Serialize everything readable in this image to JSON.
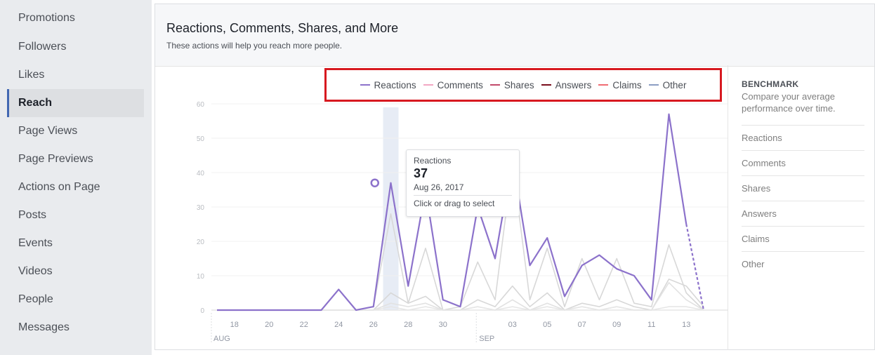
{
  "sidebar": {
    "items": [
      {
        "label": "Promotions",
        "active": false
      },
      {
        "label": "Followers",
        "active": false
      },
      {
        "label": "Likes",
        "active": false
      },
      {
        "label": "Reach",
        "active": true
      },
      {
        "label": "Page Views",
        "active": false
      },
      {
        "label": "Page Previews",
        "active": false
      },
      {
        "label": "Actions on Page",
        "active": false
      },
      {
        "label": "Posts",
        "active": false
      },
      {
        "label": "Events",
        "active": false
      },
      {
        "label": "Videos",
        "active": false
      },
      {
        "label": "People",
        "active": false
      },
      {
        "label": "Messages",
        "active": false
      }
    ]
  },
  "header": {
    "title": "Reactions, Comments, Shares, and More",
    "subtitle": "These actions will help you reach more people."
  },
  "legend": [
    {
      "label": "Reactions",
      "color": "#8c72cb"
    },
    {
      "label": "Comments",
      "color": "#f2a7c3"
    },
    {
      "label": "Shares",
      "color": "#c2496a"
    },
    {
      "label": "Answers",
      "color": "#7a0d1c"
    },
    {
      "label": "Claims",
      "color": "#f06c73"
    },
    {
      "label": "Other",
      "color": "#8b9dc3"
    }
  ],
  "tooltip": {
    "series": "Reactions",
    "value": "37",
    "date": "Aug 26, 2017",
    "hint": "Click or drag to select"
  },
  "benchmark": {
    "title": "BENCHMARK",
    "description": "Compare your average performance over time.",
    "items": [
      "Reactions",
      "Comments",
      "Shares",
      "Answers",
      "Claims",
      "Other"
    ]
  },
  "chart_data": {
    "type": "line",
    "x": [
      "Aug 17",
      "Aug 18",
      "Aug 19",
      "Aug 20",
      "Aug 21",
      "Aug 22",
      "Aug 23",
      "Aug 24",
      "Aug 25",
      "Aug 26",
      "Aug 27",
      "Aug 28",
      "Aug 29",
      "Aug 30",
      "Aug 31",
      "Sep 1",
      "Sep 2",
      "Sep 3",
      "Sep 4",
      "Sep 5",
      "Sep 6",
      "Sep 7",
      "Sep 8",
      "Sep 9",
      "Sep 10",
      "Sep 11",
      "Sep 12",
      "Sep 13",
      "Sep 14"
    ],
    "x_ticks": [
      "18",
      "20",
      "22",
      "24",
      "26",
      "28",
      "30",
      "03",
      "05",
      "07",
      "09",
      "11",
      "13"
    ],
    "month_labels": [
      "AUG",
      "SEP"
    ],
    "y_ticks": [
      0,
      10,
      20,
      30,
      40,
      50,
      60
    ],
    "ylim": [
      0,
      65
    ],
    "grid": true,
    "legend_position": "top",
    "highlight": {
      "series": "Reactions",
      "date": "Aug 26, 2017",
      "value": 37
    },
    "series": [
      {
        "name": "Reactions",
        "color": "#8c72cb",
        "values": [
          0,
          0,
          0,
          0,
          0,
          0,
          0,
          6,
          0,
          1,
          37,
          7,
          35,
          3,
          1,
          30,
          15,
          44,
          13,
          21,
          4,
          13,
          16,
          12,
          10,
          3,
          57,
          25,
          0
        ]
      },
      {
        "name": "Comments",
        "color": "#d8d8d8",
        "values": [
          0,
          0,
          0,
          0,
          0,
          0,
          0,
          0,
          0,
          1,
          28,
          2,
          18,
          0,
          1,
          14,
          3,
          43,
          3,
          18,
          1,
          15,
          3,
          15,
          2,
          1,
          19,
          5,
          0
        ]
      },
      {
        "name": "Shares",
        "color": "#d8d8d8",
        "values": [
          0,
          0,
          0,
          0,
          0,
          0,
          0,
          0,
          0,
          0,
          5,
          2,
          4,
          0,
          0,
          3,
          1,
          7,
          1,
          5,
          0,
          2,
          1,
          3,
          1,
          0,
          9,
          7,
          1
        ]
      },
      {
        "name": "Answers",
        "color": "#e2e2e2",
        "values": [
          0,
          0,
          0,
          0,
          0,
          0,
          0,
          0,
          0,
          0,
          2,
          1,
          2,
          0,
          0,
          1,
          0,
          3,
          0,
          2,
          0,
          1,
          0,
          1,
          0,
          0,
          8,
          3,
          0
        ]
      },
      {
        "name": "Claims",
        "color": "#e6e6e6",
        "values": [
          0,
          0,
          0,
          0,
          0,
          0,
          0,
          0,
          0,
          0,
          1,
          0,
          1,
          0,
          0,
          1,
          0,
          1,
          0,
          1,
          0,
          1,
          0,
          1,
          0,
          0,
          1,
          1,
          0
        ]
      },
      {
        "name": "Other",
        "color": "#e6e6e6",
        "values": [
          0,
          0,
          0,
          0,
          0,
          0,
          0,
          0,
          0,
          0,
          0,
          0,
          0,
          0,
          0,
          0,
          0,
          0,
          0,
          0,
          0,
          0,
          0,
          0,
          0,
          0,
          0,
          0,
          0
        ]
      }
    ]
  }
}
